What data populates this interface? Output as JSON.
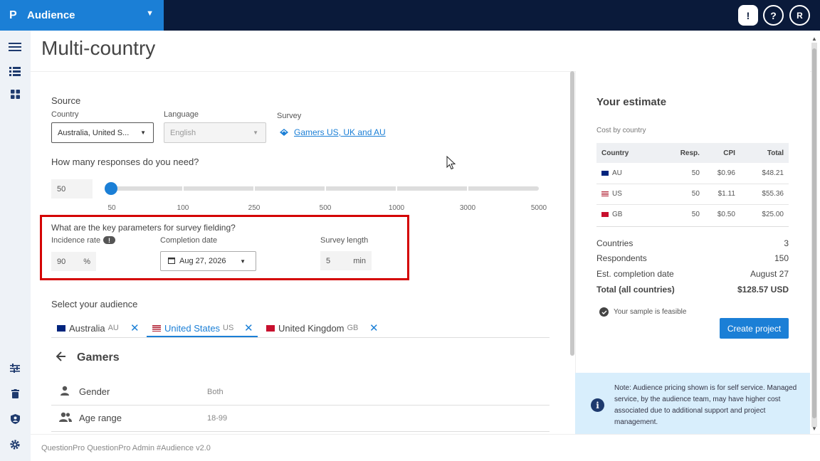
{
  "app": {
    "logo": "P",
    "name": "Audience"
  },
  "topbar": {
    "feedback_icon": "!",
    "help_icon": "?",
    "user_initial": "R"
  },
  "page": {
    "title": "Multi-country"
  },
  "source": {
    "heading": "Source",
    "country_label": "Country",
    "country_value": "Australia, United S...",
    "language_label": "Language",
    "language_value": "English",
    "survey_label": "Survey",
    "survey_link": "Gamers US, UK and AU"
  },
  "responses": {
    "question": "How many responses do you need?",
    "value": "50",
    "ticks": [
      "50",
      "100",
      "250",
      "500",
      "1000",
      "3000",
      "5000"
    ]
  },
  "fielding": {
    "question": "What are the key parameters for survey fielding?",
    "incidence_label": "Incidence rate",
    "incidence_value": "90",
    "incidence_unit": "%",
    "completion_label": "Completion date",
    "completion_value": "Aug 27, 2026",
    "length_label": "Survey length",
    "length_value": "5",
    "length_unit": "min"
  },
  "audience": {
    "heading": "Select your audience",
    "tabs": [
      {
        "label": "Australia",
        "code": "AU"
      },
      {
        "label": "United States",
        "code": "US"
      },
      {
        "label": "United Kingdom",
        "code": "GB"
      }
    ],
    "segment": "Gamers",
    "attributes": [
      {
        "name": "Gender",
        "value": "Both"
      },
      {
        "name": "Age range",
        "value": "18-99"
      }
    ]
  },
  "estimate": {
    "title": "Your estimate",
    "subtitle": "Cost by country",
    "headers": [
      "Country",
      "Resp.",
      "CPI",
      "Total"
    ],
    "rows": [
      {
        "country": "AU",
        "resp": "50",
        "cpi": "$0.96",
        "total": "$48.21"
      },
      {
        "country": "US",
        "resp": "50",
        "cpi": "$1.11",
        "total": "$55.36"
      },
      {
        "country": "GB",
        "resp": "50",
        "cpi": "$0.50",
        "total": "$25.00"
      }
    ],
    "summary": [
      {
        "label": "Countries",
        "value": "3"
      },
      {
        "label": "Respondents",
        "value": "150"
      },
      {
        "label": "Est. completion date",
        "value": "August 27"
      },
      {
        "label": "Total (all countries)",
        "value": "$128.57 USD"
      }
    ],
    "feasible": "Your sample is feasible",
    "create_button": "Create project",
    "note": "Note: Audience pricing shown is for self service. Managed service, by the audience team, may have higher cost associated due to additional support and project management."
  },
  "footer": {
    "text": "QuestionPro QuestionPro Admin  #Audience v2.0"
  },
  "colors": {
    "brand": "#1b7fd6",
    "topbar": "#0a1a3a",
    "highlight": "#d40000"
  }
}
